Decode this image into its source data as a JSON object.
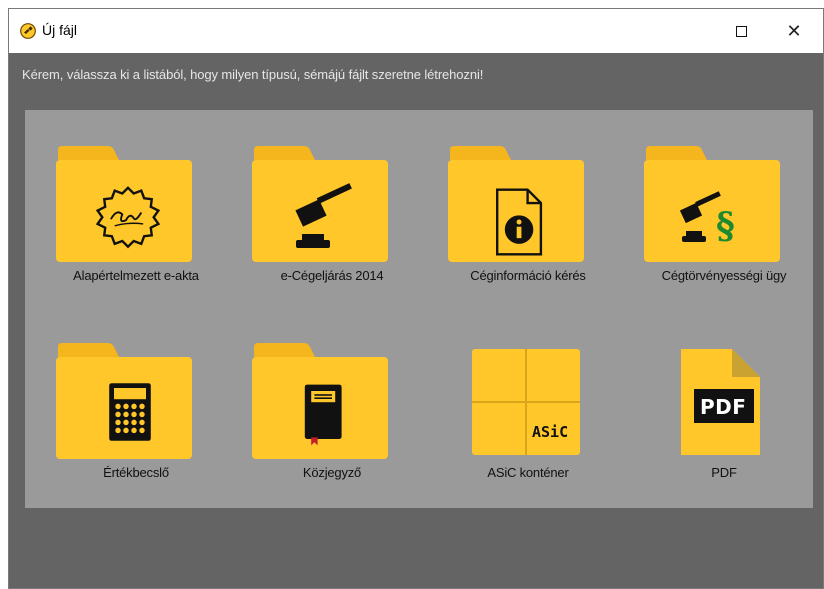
{
  "window": {
    "title": "Új fájl",
    "close_glyph": "✕"
  },
  "instruction": "Kérem, válassza ki a listából, hogy milyen típusú, sémájú fájlt szeretne létrehozni!",
  "tiles": [
    {
      "label": "Alapértelmezett e-akta",
      "icon": "seal-signature-icon"
    },
    {
      "label": "e-Cégeljárás 2014",
      "icon": "gavel-icon"
    },
    {
      "label": "Céginformáció kérés",
      "icon": "info-document-icon"
    },
    {
      "label": "Cégtörvényességi ügy",
      "icon": "gavel-paragraph-icon"
    },
    {
      "label": "Értékbecslő",
      "icon": "calculator-icon"
    },
    {
      "label": "Közjegyző",
      "icon": "notebook-icon"
    },
    {
      "label": "ASiC konténer",
      "icon": "asic-container-icon",
      "badge": "ASiC"
    },
    {
      "label": "PDF",
      "icon": "pdf-file-icon",
      "badge": "PDF"
    }
  ],
  "colors": {
    "folder": "#ffc72a",
    "folder_tab": "#f4b51d",
    "panel": "#9a9a9a",
    "window_bg": "#646464"
  }
}
